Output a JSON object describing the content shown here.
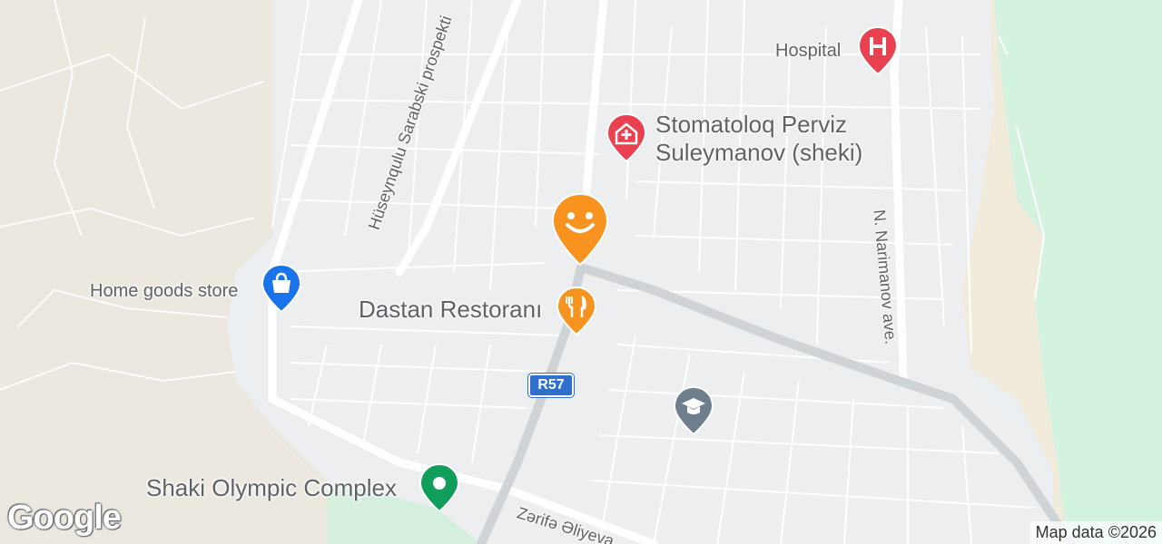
{
  "map": {
    "pois": {
      "hospital": {
        "label": "Hospital",
        "icon": "hospital-icon",
        "color": "#e94150"
      },
      "dentist": {
        "label_line1": "Stomatoloq Perviz",
        "label_line2": "Suleymanov (sheki)",
        "icon": "medical-cross-icon",
        "color": "#e94150"
      },
      "current": {
        "icon": "smiley-marker-icon",
        "color": "#f7931e"
      },
      "restaurant": {
        "label": "Dastan Restoranı",
        "icon": "fork-knife-icon",
        "color": "#f7931e"
      },
      "store": {
        "label": "Home goods store",
        "icon": "shopping-bag-icon",
        "color": "#1a73e8"
      },
      "school": {
        "icon": "graduation-cap-icon",
        "color": "#6f7e8c"
      },
      "olympic": {
        "label": "Shaki Olympic Complex",
        "icon": "park-icon",
        "color": "#119e5a"
      }
    },
    "streets": {
      "sarabski": "Hüseynqulu Sarabski prospekti",
      "narimanov": "N. Narimanov ave.",
      "aliyeva": "Zərifə Əliyeva"
    },
    "route_shield": "R57",
    "logo": "Google",
    "attribution": "Map data ©2026"
  }
}
